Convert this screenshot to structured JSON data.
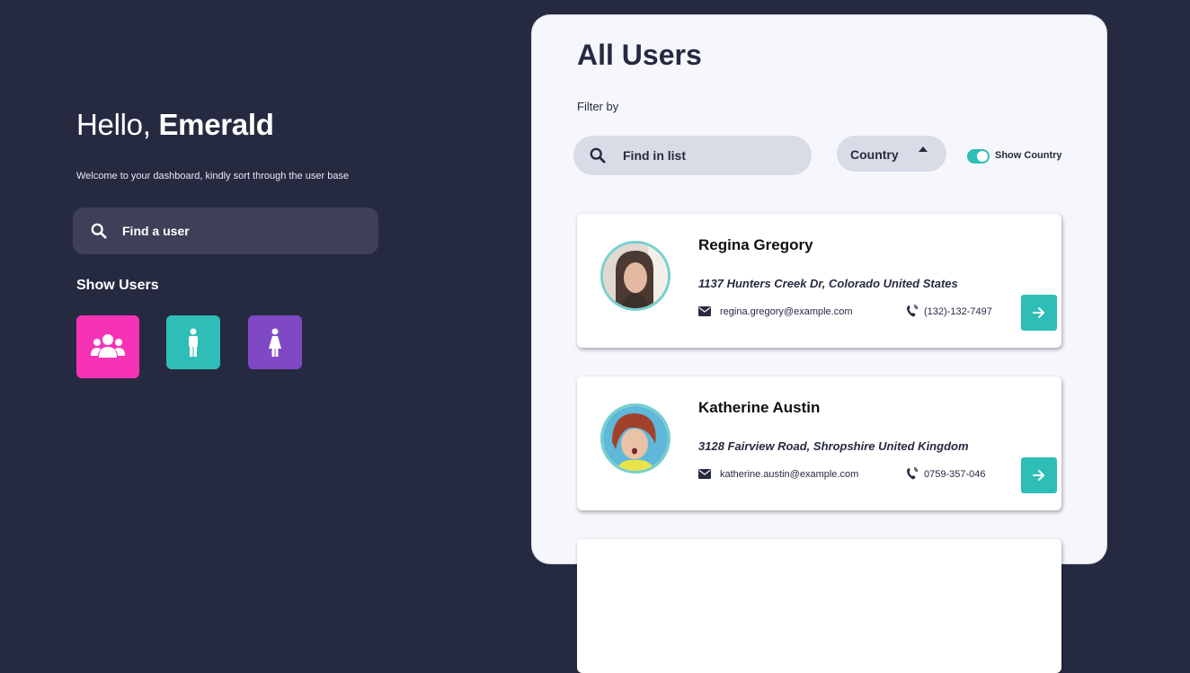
{
  "left": {
    "greeting": "Hello,",
    "user_name": "Emerald",
    "welcome": "Welcome to your dashboard, kindly sort through the user base",
    "find_user_label": "Find a user",
    "show_users_heading": "Show Users"
  },
  "panel": {
    "title": "All Users",
    "filter_label": "Filter by",
    "search_placeholder": "Find in list",
    "country_label": "Country",
    "toggle_label": "Show Country",
    "toggle_on": true
  },
  "users": [
    {
      "name": "Regina Gregory",
      "address": "1137 Hunters Creek Dr, Colorado United States",
      "email": "regina.gregory@example.com",
      "phone": "(132)-132-7497"
    },
    {
      "name": "Katherine Austin",
      "address": "3128 Fairview Road, Shropshire United Kingdom",
      "email": "katherine.austin@example.com",
      "phone": "0759-357-046"
    }
  ],
  "colors": {
    "background": "#262a41",
    "panel": "#f6f7fd",
    "accent_teal": "#2fbdb7",
    "accent_pink": "#f733b5",
    "accent_purple": "#7f48c4"
  },
  "icons": {
    "search": "search-icon",
    "all_users": "users-group-icon",
    "male": "male-icon",
    "female": "female-icon",
    "email": "envelope-icon",
    "phone": "phone-icon",
    "arrow": "arrow-right-icon"
  }
}
